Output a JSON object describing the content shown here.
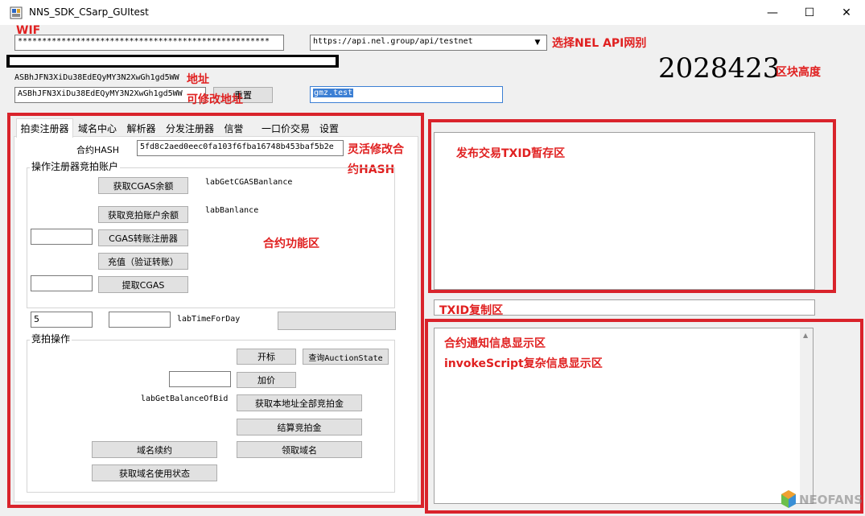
{
  "window": {
    "title": "NNS_SDK_CSarp_GUItest",
    "minimize": "—",
    "maximize": "☐",
    "close": "✕"
  },
  "top": {
    "wif_value": "****************************************************",
    "api_selected": "https://api.nel.group/api/testnet",
    "address_label": "ASBhJFN3XiDu38EdEQyMY3N2XwGh1gd5WW",
    "address_value": "ASBhJFN3XiDu38EdEQyMY3N2XwGh1gd5WW",
    "reset_button": "重置",
    "domain_value": "gmz.test",
    "block_height": "2028423"
  },
  "annotations": {
    "wif": "WIF",
    "choose_api": "选择NEL API网别",
    "address": "地址",
    "address_editable": "可修改地址",
    "block_height": "区块高度",
    "flex_hash_1": "灵活修改合",
    "flex_hash_2": "约HASH",
    "contract_area": "合约功能区",
    "txid_store": "发布交易TXID暂存区",
    "txid_copy": "TXID复制区",
    "notify_1": "合约通知信息显示区",
    "notify_2": "invokeScript复杂信息显示区"
  },
  "tabs": [
    "拍卖注册器",
    "域名中心",
    "解析器",
    "分发注册器",
    "信誉",
    "一口价交易",
    "设置"
  ],
  "panel": {
    "hash_label": "合约HASH",
    "hash_value": "5fd8c2aed0eec0fa103f6fba16748b453baf5b2e",
    "account_group": "操作注册器竞拍账户",
    "btn_get_cgas": "获取CGAS余额",
    "lab_cgas": "labGetCGASBanlance",
    "btn_get_bid_balance": "获取竞拍账户余额",
    "lab_balance": "labBanlance",
    "btn_cgas_transfer": "CGAS转账注册器",
    "btn_recharge": "充值（验证转账）",
    "btn_withdraw": "提取CGAS",
    "days_value": "5",
    "lab_time": "labTimeForDay",
    "auction_group": "竞拍操作",
    "btn_open_bid": "开标",
    "btn_query_state": "查询AuctionState",
    "btn_raise": "加价",
    "lab_bid_balance": "labGetBalanceOfBid",
    "btn_get_all_bid": "获取本地址全部竞拍金",
    "btn_settle": "结算竞拍金",
    "btn_renew": "域名续约",
    "btn_claim": "领取域名",
    "btn_domain_state": "获取域名使用状态"
  },
  "watermark": "NEOFANS"
}
